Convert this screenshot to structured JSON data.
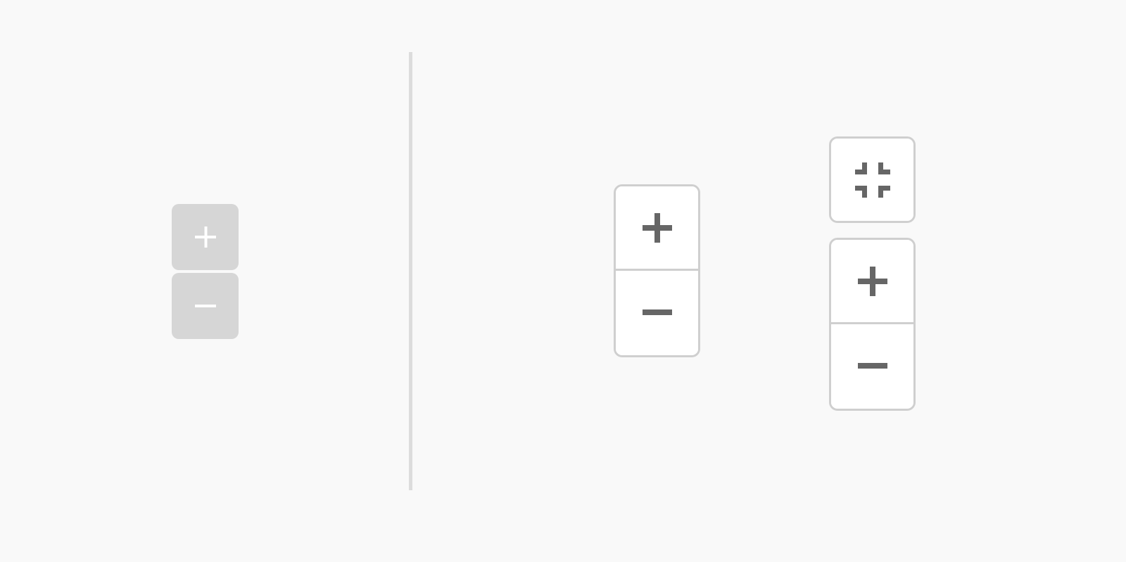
{
  "colors": {
    "background": "#f9f9f9",
    "divider": "#dcdcdc",
    "old_button_bg": "#d6d6d6",
    "old_icon": "#ffffff",
    "new_border": "#cfcfcf",
    "new_button_bg": "#ffffff",
    "new_icon": "#666666"
  },
  "old_controls": {
    "zoom_in_icon": "plus-icon",
    "zoom_out_icon": "minus-icon"
  },
  "new_controls": {
    "zoom_group_a": {
      "zoom_in_icon": "plus-icon",
      "zoom_out_icon": "minus-icon"
    },
    "fit_control": {
      "icon": "exit-fullscreen-icon"
    },
    "zoom_group_b": {
      "zoom_in_icon": "plus-icon",
      "zoom_out_icon": "minus-icon"
    }
  }
}
